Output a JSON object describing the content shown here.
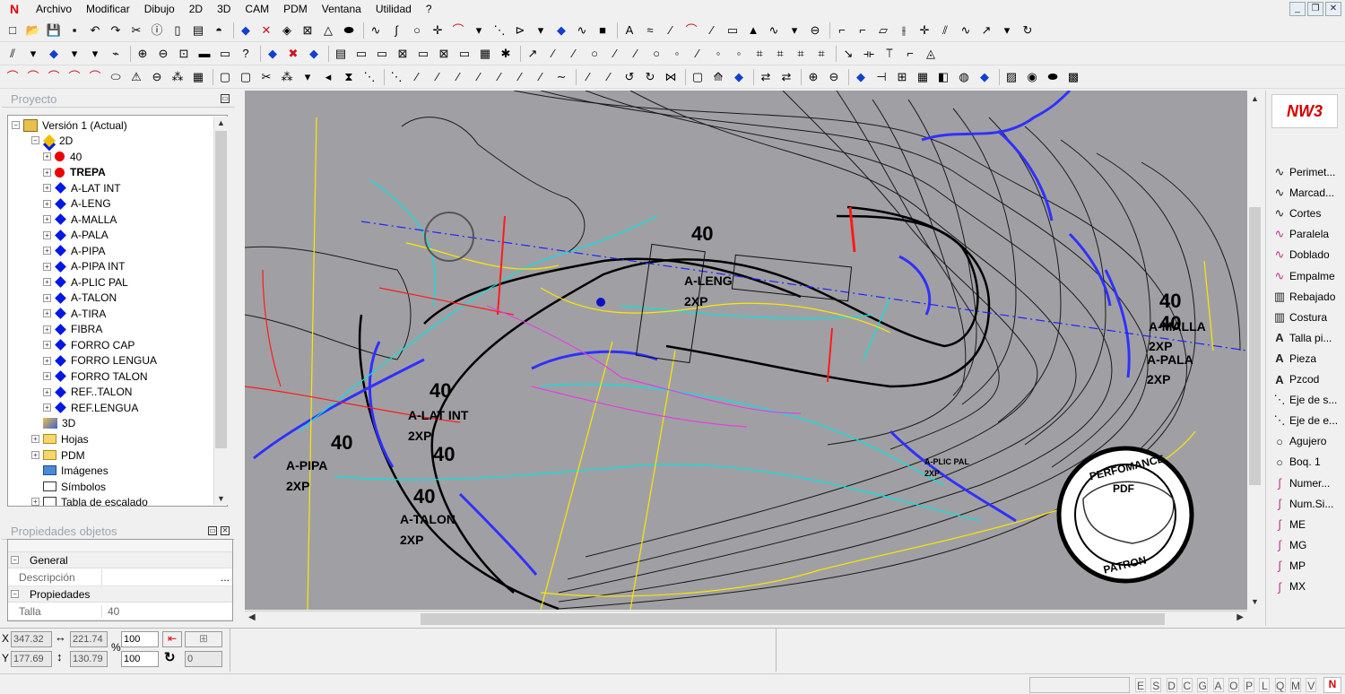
{
  "menu": {
    "items": [
      "Archivo",
      "Modificar",
      "Dibujo",
      "2D",
      "3D",
      "CAM",
      "PDM",
      "Ventana",
      "Utilidad",
      "?"
    ]
  },
  "window_buttons": [
    "_",
    "❐",
    "✕"
  ],
  "project_panel": {
    "title": "Proyecto"
  },
  "tree": {
    "root": "Versión 1 (Actual)",
    "group_2d": "2D",
    "layers": [
      {
        "label": "40",
        "marker": "red-dot"
      },
      {
        "label": "TREPA",
        "marker": "red-dot",
        "bold": true
      },
      {
        "label": "A-LAT INT",
        "marker": "blue-diamond"
      },
      {
        "label": "A-LENG",
        "marker": "blue-diamond"
      },
      {
        "label": "A-MALLA",
        "marker": "blue-diamond"
      },
      {
        "label": "A-PALA",
        "marker": "blue-diamond"
      },
      {
        "label": "A-PIPA",
        "marker": "blue-diamond"
      },
      {
        "label": "A-PIPA INT",
        "marker": "blue-diamond"
      },
      {
        "label": "A-PLIC PAL",
        "marker": "blue-diamond"
      },
      {
        "label": "A-TALON",
        "marker": "blue-diamond"
      },
      {
        "label": "A-TIRA",
        "marker": "blue-diamond"
      },
      {
        "label": "FIBRA",
        "marker": "blue-diamond"
      },
      {
        "label": "FORRO CAP",
        "marker": "blue-diamond"
      },
      {
        "label": "FORRO LENGUA",
        "marker": "blue-diamond"
      },
      {
        "label": "FORRO TALON",
        "marker": "blue-diamond"
      },
      {
        "label": "REF..TALON",
        "marker": "blue-diamond"
      },
      {
        "label": "REF.LENGUA",
        "marker": "blue-diamond"
      }
    ],
    "group_3d": "3D",
    "hojas": "Hojas",
    "pdm": "PDM",
    "imagenes": "Imágenes",
    "simbolos": "Símbolos",
    "tabla": "Tabla de escalado"
  },
  "properties_panel": {
    "title": "Propiedades objetos",
    "general": "General",
    "descripcion_label": "Descripción",
    "descripcion_btn": "...",
    "propiedades": "Propiedades",
    "talla_label": "Talla",
    "talla_value": "40"
  },
  "canvas_labels": {
    "size_40": "40",
    "leng": "A-LENG",
    "x2": "2XP",
    "lat_int": "A-LAT INT",
    "pipa": "A-PIPA",
    "talon": "A-TALON",
    "malla": "A-MALLA",
    "pala": "A-PALA",
    "plic_pal": "A-PLIC PAL",
    "stamp_perf": "PERFOMANCE",
    "stamp_pdf": "PDF",
    "stamp_patron": "PATRON"
  },
  "right_tools": {
    "logo": "NW3",
    "items": [
      {
        "label": "Perimet...",
        "glyph": "∿"
      },
      {
        "label": "Marcad...",
        "glyph": "∿"
      },
      {
        "label": "Cortes",
        "glyph": "∿"
      },
      {
        "label": "Paralela",
        "glyph": "∿"
      },
      {
        "label": "Doblado",
        "glyph": "∿"
      },
      {
        "label": "Empalme",
        "glyph": "∿"
      },
      {
        "label": "Rebajado",
        "glyph": "▥"
      },
      {
        "label": "Costura",
        "glyph": "▥"
      },
      {
        "label": "Talla pi...",
        "glyph": "A"
      },
      {
        "label": "Pieza",
        "glyph": "A"
      },
      {
        "label": "Pzcod",
        "glyph": "A"
      },
      {
        "label": "Eje de s...",
        "glyph": "⋱"
      },
      {
        "label": "Eje de e...",
        "glyph": "⋱"
      },
      {
        "label": "Agujero",
        "glyph": "○"
      },
      {
        "label": "Boq. 1",
        "glyph": "○"
      },
      {
        "label": "Numer...",
        "glyph": "∫"
      },
      {
        "label": "Num.Si...",
        "glyph": "∫"
      },
      {
        "label": "ME",
        "glyph": "∫"
      },
      {
        "label": "MG",
        "glyph": "∫"
      },
      {
        "label": "MP",
        "glyph": "∫"
      },
      {
        "label": "MX",
        "glyph": "∫"
      }
    ]
  },
  "status": {
    "x_label": "X",
    "y_label": "Y",
    "x_value": "347.32",
    "y_value": "177.69",
    "width_value": "221.74",
    "height_value": "130.79",
    "percent_label": "%",
    "scale_x": "100",
    "scale_y": "100",
    "rotation": "0"
  },
  "statusbar_letters": [
    "E",
    "S",
    "D",
    "C",
    "G",
    "A",
    "O",
    "P",
    "L",
    "Q",
    "M",
    "V"
  ],
  "colors": {
    "canvas_bg": "#a0a0a4",
    "accent_red": "#e00000",
    "layer_blue": "#0017e6"
  }
}
